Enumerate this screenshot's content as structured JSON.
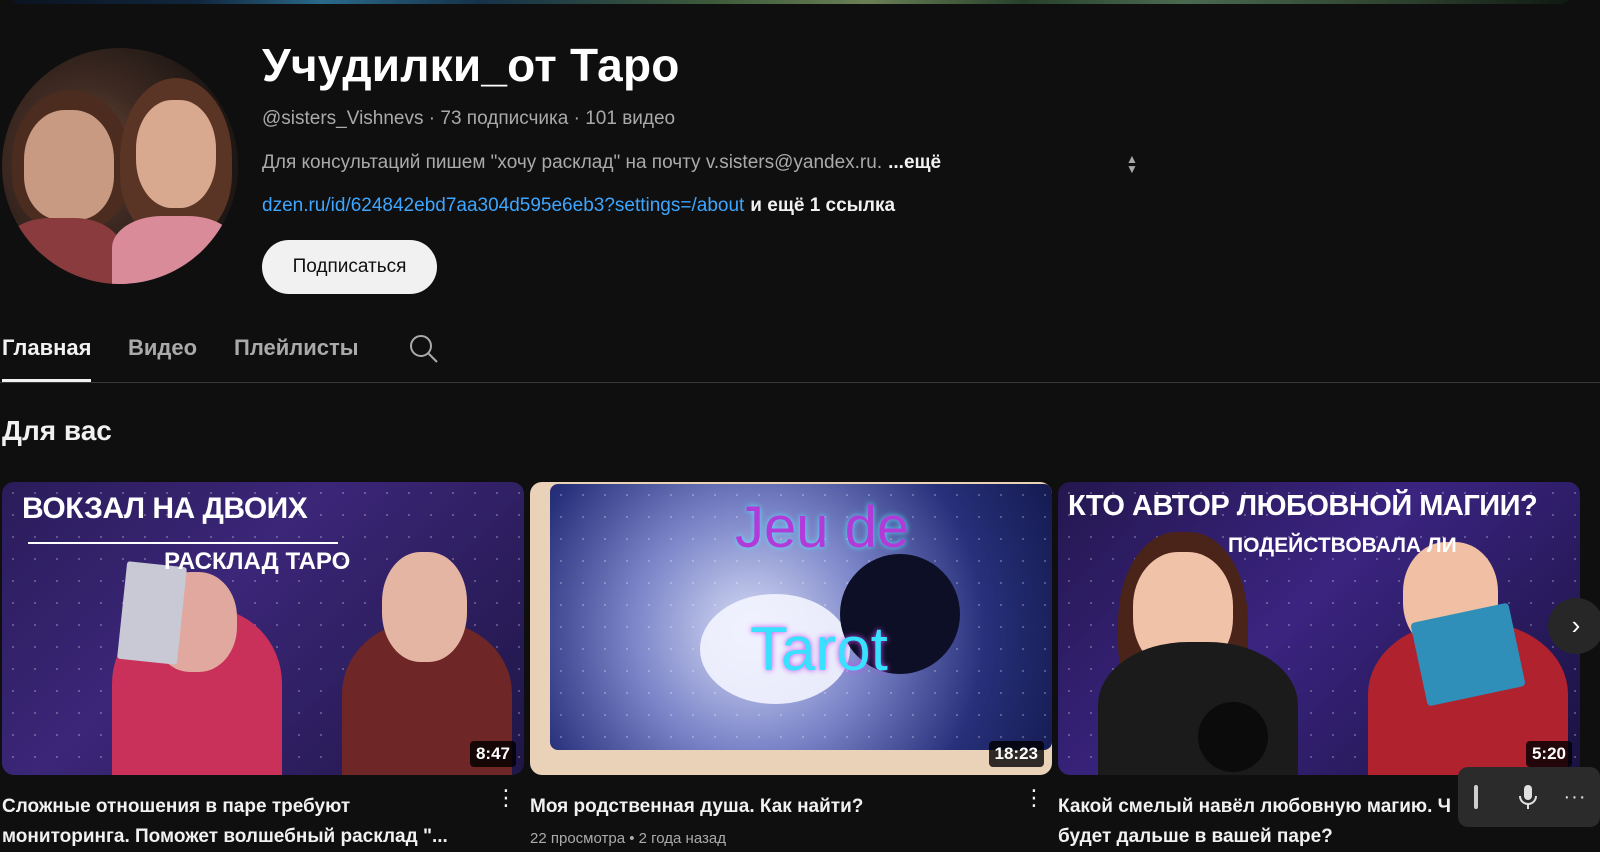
{
  "channel": {
    "name": "Учудилки_от Таро",
    "handle": "@sisters_Vishnevs",
    "subscribers": "73 подписчика",
    "videos_count": "101 видео",
    "description": "Для консультаций пишем \"хочу расклад\" на почту v.sisters@yandex.ru.",
    "description_more": "...ещё",
    "link": "dzen.ru/id/624842ebd7aa304d595e6eb3?settings=/about",
    "link_extra": "и ещё 1 ссылка",
    "subscribe_label": "Подписаться",
    "separator": "·"
  },
  "tabs": [
    {
      "label": "Главная",
      "active": true
    },
    {
      "label": "Видео",
      "active": false
    },
    {
      "label": "Плейлисты",
      "active": false
    }
  ],
  "section": {
    "title": "Для вас"
  },
  "videos": [
    {
      "thumb_text_1": "ВОКЗАЛ НА ДВОИХ",
      "thumb_text_2": "РАСКЛАД ТАРО",
      "duration": "8:47",
      "title": "Сложные отношения в паре требуют мониторинга. Поможет волшебный расклад \"...",
      "meta": ""
    },
    {
      "thumb_text_1": "Jeu de",
      "thumb_text_2": "Tarot",
      "duration": "18:23",
      "title": "Моя родственная душа. Как найти?",
      "meta": "22 просмотра • 2 года назад"
    },
    {
      "thumb_text_1": "КТО АВТОР ЛЮБОВНОЙ МАГИИ?",
      "thumb_text_2": "ПОДЕЙСТВОВАЛА ЛИ",
      "duration": "5:20",
      "title": "Какой смелый навёл любовную магию. Ч будет дальше в вашей паре?",
      "meta": ""
    }
  ],
  "icons": {
    "search": "search-icon",
    "next": "chevron-right-icon",
    "more": "more-vert-icon",
    "mic": "mic-icon",
    "sort": "unfold-icon"
  },
  "colors": {
    "background": "#0f0f0f",
    "link": "#3ea6ff",
    "subscribe_bg": "#f1f1f1"
  }
}
